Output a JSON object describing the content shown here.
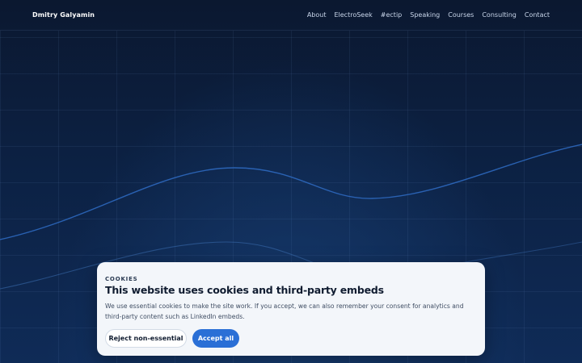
{
  "site": {
    "brand": "Dmitry Galyamin"
  },
  "nav": {
    "items": [
      {
        "label": "About"
      },
      {
        "label": "ElectroSeek"
      },
      {
        "label": "#ectip"
      },
      {
        "label": "Speaking"
      },
      {
        "label": "Courses"
      },
      {
        "label": "Consulting"
      },
      {
        "label": "Contact"
      }
    ]
  },
  "cookies": {
    "kicker": "COOKIES",
    "title": "This website uses cookies and third-party embeds",
    "body": "We use essential cookies to make the site work. If you accept, we can also remember your consent for analytics and third-party content such as LinkedIn embeds.",
    "reject_label": "Reject non-essential",
    "accept_label": "Accept all"
  },
  "colors": {
    "background": "#0c2143",
    "accent": "#2a6fd6",
    "banner": "#f3f6fa"
  }
}
